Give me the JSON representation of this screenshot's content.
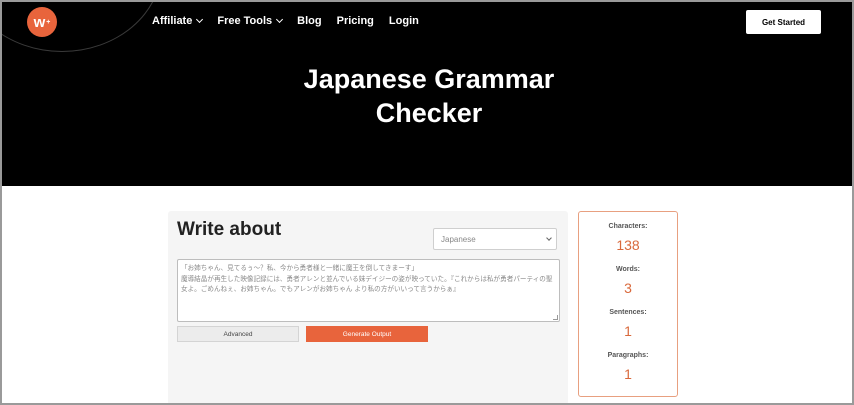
{
  "header": {
    "logo_letter": "w",
    "logo_mark": "+",
    "nav": [
      {
        "label": "Affiliate",
        "dropdown": true
      },
      {
        "label": "Free Tools",
        "dropdown": true
      },
      {
        "label": "Blog",
        "dropdown": false
      },
      {
        "label": "Pricing",
        "dropdown": false
      },
      {
        "label": "Login",
        "dropdown": false
      }
    ],
    "cta_label": "Get Started"
  },
  "hero": {
    "title_line1": "Japanese Grammar",
    "title_line2": "Checker"
  },
  "editor": {
    "title": "Write about",
    "language_selected": "Japanese",
    "text": "「お姉ちゃん、見てるぅ～？私、今から勇者様と一緒に魔王を倒してきまーす」\n魔導結晶が再生した映像記録には、勇者アレンと並んでいる妹デイジーの姿が映っていた。『これからは私が勇者パーティの聖女よ。ごめんねぇ、お姉ちゃん。でもアレンがお姉ちゃん より私の方がいいって言うからぁ』",
    "advanced_label": "Advanced",
    "generate_label": "Generate Output"
  },
  "stats": [
    {
      "label": "Characters:",
      "value": "138"
    },
    {
      "label": "Words:",
      "value": "3"
    },
    {
      "label": "Sentences:",
      "value": "1"
    },
    {
      "label": "Paragraphs:",
      "value": "1"
    }
  ],
  "colors": {
    "accent": "#e8643c",
    "hero_bg": "#000000",
    "panel_bg": "#f5f5f5"
  }
}
